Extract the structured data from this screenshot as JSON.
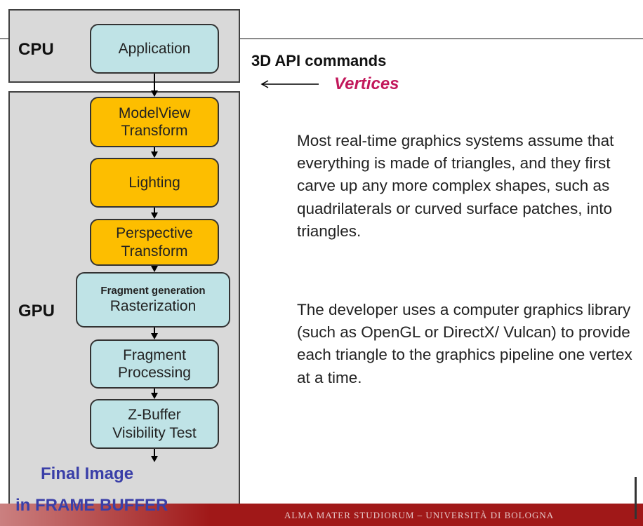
{
  "regions": {
    "cpu_label": "CPU",
    "gpu_label": "GPU"
  },
  "pipeline": [
    {
      "lines": [
        "Application"
      ]
    },
    {
      "lines": [
        "ModelView",
        "Transform"
      ]
    },
    {
      "lines": [
        "Lighting"
      ]
    },
    {
      "lines": [
        "Perspective",
        "Transform"
      ]
    },
    {
      "small": "Fragment generation",
      "lines": [
        "Rasterization"
      ]
    },
    {
      "lines": [
        "Fragment",
        "Processing"
      ]
    },
    {
      "lines": [
        "Z-Buffer",
        "Visibility Test"
      ]
    }
  ],
  "output": {
    "line1": "Final Image",
    "line2": "in FRAME BUFFER"
  },
  "annotations": {
    "api_commands": "3D API commands",
    "vertices": "Vertices"
  },
  "paragraphs": [
    "Most real-time graphics systems assume that everything is made of triangles, and they first carve up any more complex shapes, such as quadrilaterals or curved surface patches, into triangles.",
    "The developer uses a computer graphics library (such as OpenGL or DirectX/ Vulcan) to provide each triangle to the graphics pipeline one vertex at a time."
  ],
  "footer": {
    "institution": "ALMA MATER STUDIORUM – UNIVERSITÀ DI BOLOGNA"
  },
  "colors": {
    "application_stage": "#bfe3e6",
    "geometry_stage": "#fdbe00",
    "vertices_text": "#c2185b",
    "final_image_text": "#3a3fa8",
    "footer_band": "#a01818"
  }
}
